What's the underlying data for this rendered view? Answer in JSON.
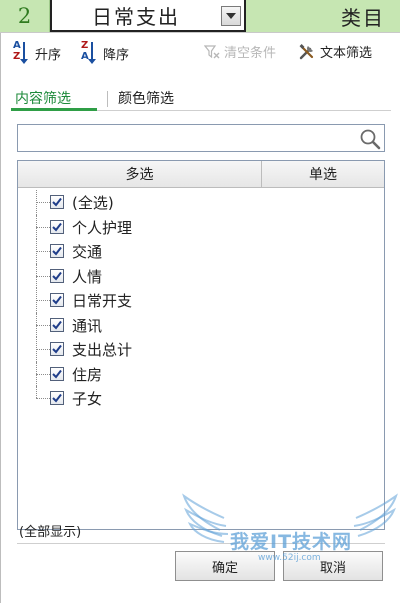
{
  "sheet": {
    "row_number": "2",
    "cell_a": "日常支出",
    "cell_b": "类目",
    "row_color": "#c6e6b2"
  },
  "toolbar": {
    "sort_asc_label": "升序",
    "sort_desc_label": "降序",
    "clear_label": "清空条件",
    "text_filter_label": "文本筛选",
    "sort_asc_icon": "sort-ascending-icon",
    "sort_desc_icon": "sort-descending-icon",
    "clear_icon": "funnel-clear-icon",
    "text_filter_icon": "tools-icon"
  },
  "tabs": [
    {
      "label": "内容筛选",
      "active": true
    },
    {
      "label": "颜色筛选",
      "active": false
    }
  ],
  "search": {
    "placeholder": "",
    "value": "",
    "icon": "search-icon"
  },
  "list": {
    "header_multi": "多选",
    "header_single": "单选",
    "items": [
      {
        "label": "(全选)",
        "checked": true
      },
      {
        "label": "个人护理",
        "checked": true
      },
      {
        "label": "交通",
        "checked": true
      },
      {
        "label": "人情",
        "checked": true
      },
      {
        "label": "日常开支",
        "checked": true
      },
      {
        "label": "通讯",
        "checked": true
      },
      {
        "label": "支出总计",
        "checked": true
      },
      {
        "label": "住房",
        "checked": true
      },
      {
        "label": "子女",
        "checked": true
      }
    ]
  },
  "status": "(全部显示)",
  "buttons": {
    "ok": "确定",
    "cancel": "取消"
  },
  "watermark": {
    "text": "我爱IT技术网",
    "url": "www.52ij.com"
  },
  "colors": {
    "accent_green": "#2f9e46",
    "checkbox_check": "#1f3d8a",
    "watermark": "#5ea0d7"
  }
}
